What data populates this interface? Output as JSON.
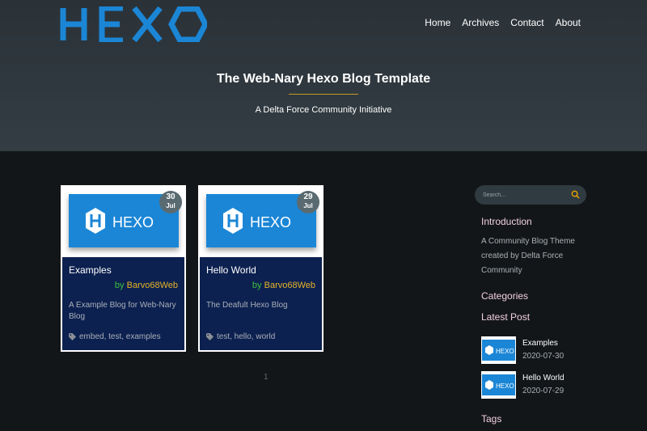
{
  "brand": {
    "logo_text": "HEXO",
    "logo_color": "#1b86d6"
  },
  "nav": {
    "items": [
      "Home",
      "Archives",
      "Contact",
      "About"
    ]
  },
  "hero": {
    "title": "The Web-Nary Hexo Blog Template",
    "subtitle": "A Delta Force Community Initiative",
    "accent": "#c59a28"
  },
  "posts": [
    {
      "title": "Examples",
      "author_prefix": "by",
      "author": "Barvo68Web",
      "day": "30",
      "month": "Jul",
      "description": "A Example Blog for Web-Nary Blog",
      "tags": "embed, test, examples",
      "image_text": "HEXO"
    },
    {
      "title": "Hello World",
      "author_prefix": "by",
      "author": "Barvo68Web",
      "day": "29",
      "month": "Jul",
      "description": "The Deafult Hexo Blog",
      "tags": "test, hello, world",
      "image_text": "HEXO"
    }
  ],
  "pagination": {
    "current": "1"
  },
  "sidebar": {
    "search_placeholder": "Search...",
    "intro_heading": "Introduction",
    "intro_text": "A Community Blog Theme created by Delta Force Community",
    "categories_heading": "Categories",
    "latest_heading": "Latest Post",
    "latest": [
      {
        "title": "Examples",
        "date": "2020-07-30",
        "image_text": "HEXO"
      },
      {
        "title": "Hello World",
        "date": "2020-07-29",
        "image_text": "HEXO"
      }
    ],
    "tags_heading": "Tags"
  },
  "colors": {
    "card_bg": "#0c2150",
    "author_link": "#e8b327",
    "author_prefix": "#3fbf3f",
    "search_icon": "#e8a300"
  }
}
